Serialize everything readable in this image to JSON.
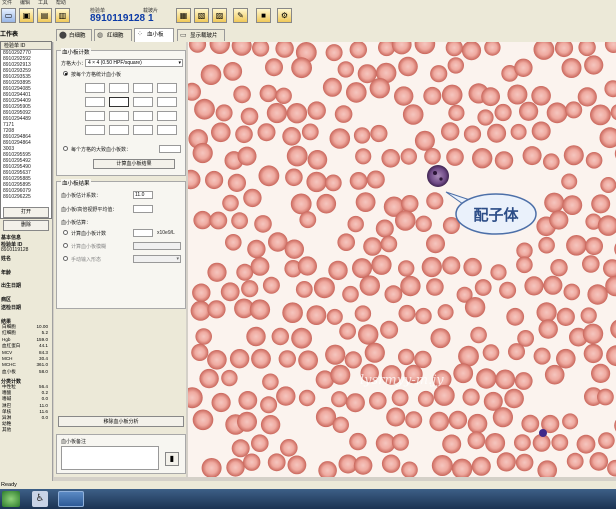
{
  "menu": {
    "items": [
      "文件",
      "编辑",
      "工具",
      "帮助"
    ]
  },
  "toolbar": {
    "barcode_label": "检验单",
    "barcode_value": "8910119128",
    "piece_label": "载玻片",
    "piece_value": "1"
  },
  "sidebar": {
    "title": "工作表",
    "list_header": "检验单 ID",
    "samples": [
      "8910292770",
      "8910292592",
      "8910292913",
      "8910293259",
      "8910293535",
      "8910293895",
      "8910294085",
      "8910294401",
      "8910294409",
      "8910295905",
      "8910295092",
      "8910294489",
      "7171",
      "7208",
      "8910294864",
      "8910294864",
      "3003",
      "8910295595",
      "8910295492",
      "8910295490",
      "8910295637",
      "8910295885",
      "8910295895",
      "8910296079",
      "8910296225"
    ],
    "open_button": "打开",
    "delete_button": "删除",
    "info_title": "基本信息",
    "barcode_label": "检验单 ID",
    "barcode_value": "8910119128",
    "name_label": "姓名",
    "age_label": "年龄",
    "birth_label": "出生日期",
    "ward_label": "病区",
    "date_label": "送检日期",
    "result_title": "结果",
    "results": [
      {
        "name": "白细胞",
        "value": "10.00"
      },
      {
        "name": "红细胞",
        "value": "5.2"
      },
      {
        "name": "Hgb",
        "value": "159.0"
      },
      {
        "name": "血红蛋白",
        "value": "44.1"
      },
      {
        "name": "MCV",
        "value": "84.3"
      },
      {
        "name": "MCH",
        "value": "30.4"
      },
      {
        "name": "MCHC",
        "value": "361.0"
      },
      {
        "name": "血小板",
        "value": "58.0"
      }
    ],
    "diff_title": "分类计数",
    "diffs": [
      {
        "name": "中性粒",
        "value": "56.4"
      },
      {
        "name": "嗜酸",
        "value": "0.2"
      },
      {
        "name": "嗜碱",
        "value": "0.0"
      },
      {
        "name": "淋巴",
        "value": "11.0"
      },
      {
        "name": "单核",
        "value": "11.6"
      },
      {
        "name": "异淋",
        "value": "0.0"
      },
      {
        "name": "幼稚",
        "value": ""
      },
      {
        "name": "其他",
        "value": ""
      }
    ]
  },
  "tabs": [
    {
      "label": "白细胞",
      "icon": "wbc-icon"
    },
    {
      "label": "红细胞",
      "icon": "rbc-icon"
    },
    {
      "label": "血小板",
      "icon": "platelet-icon",
      "active": true
    },
    {
      "label": "显示载玻片",
      "icon": "slide-icon"
    }
  ],
  "panel": {
    "count_group_title": "血小板计数",
    "grid_size_label": "方格大小：",
    "grid_size_value": "4 × 4 (0.50 HPF/square)",
    "mode_each_label": "按每个方格统计血小板",
    "mode_large_label": "每个方格的大致血小板数：",
    "calc_button": "计算血小板结果",
    "result_group_title": "血小板结果",
    "factor_label": "血小板估计系数：",
    "factor_value": "11.0",
    "avg_label": "血小板/高倍视野平均值：",
    "estimate_title": "血小板估算：",
    "est_count_label": "计算血小板计数",
    "est_count_unit": "x10e9/L",
    "est_fuzzy_label": "计算血小板模糊",
    "est_manual_label": "手动输入形态",
    "analyze_button": "移除血小板分析",
    "note_label": "血小板备注"
  },
  "scope": {
    "callout": "配子体",
    "watermark": "lysrmyy-m.jy"
  },
  "status": {
    "text": "Ready"
  }
}
